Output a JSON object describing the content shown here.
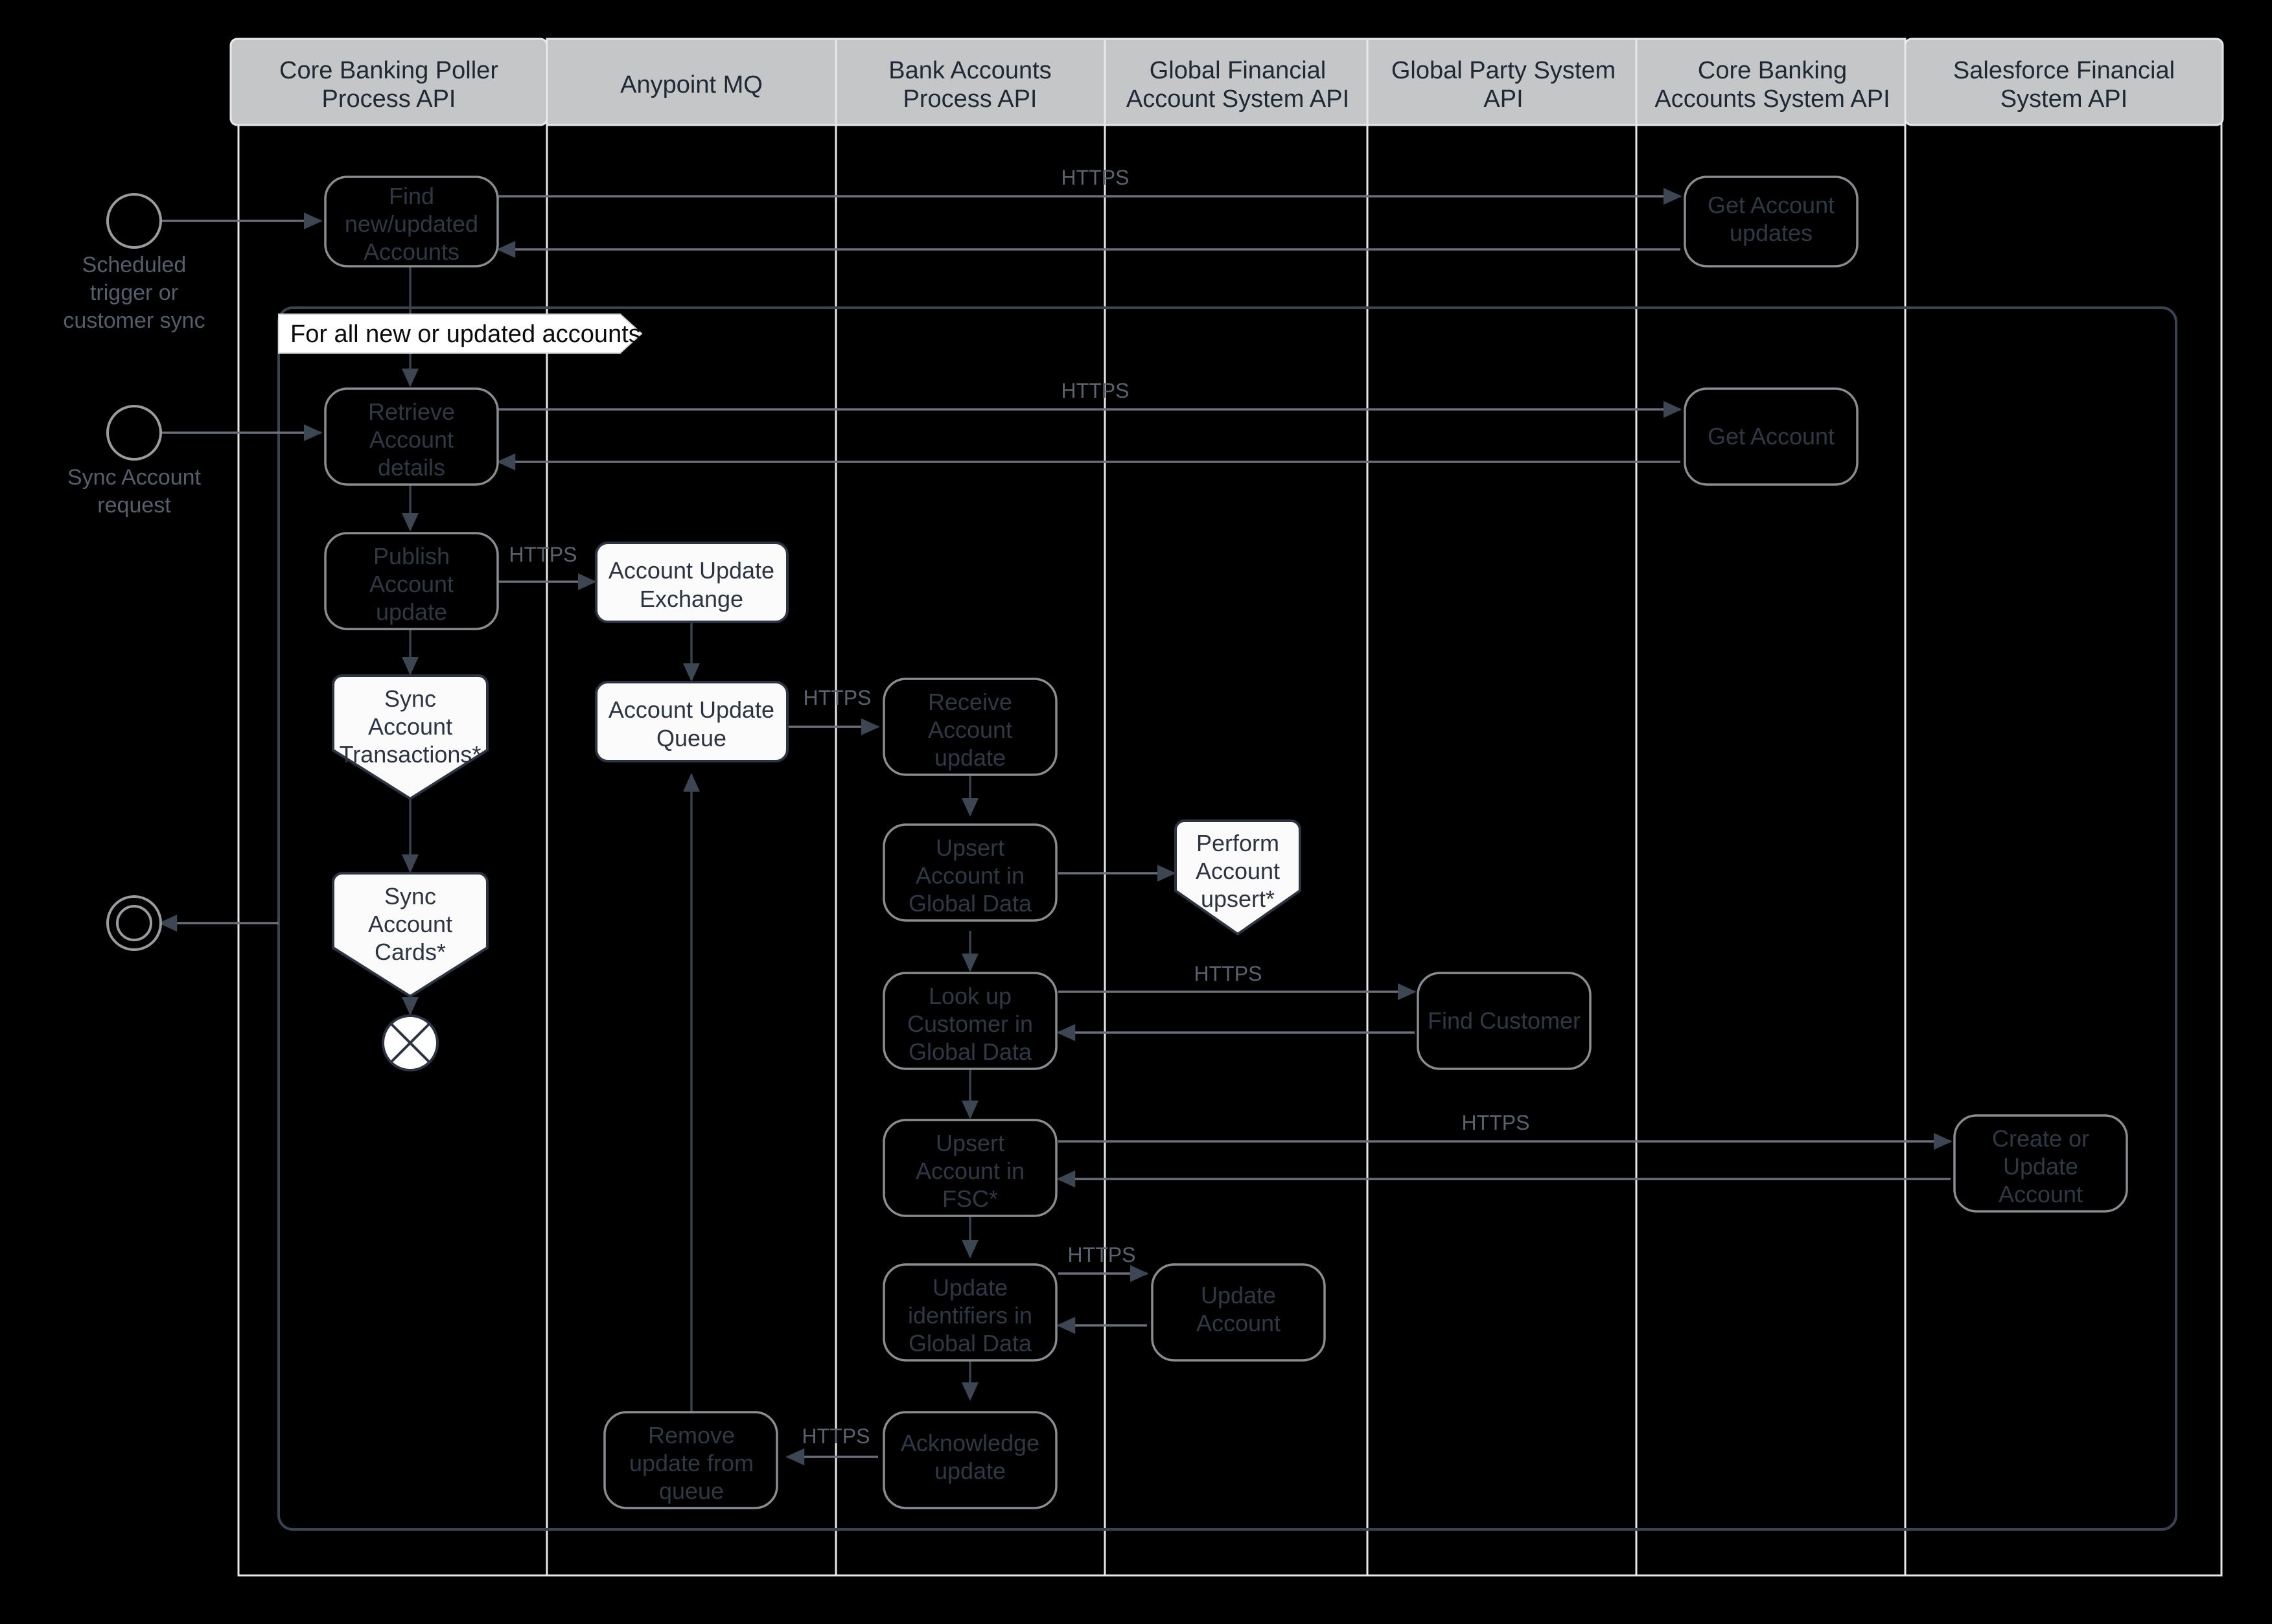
{
  "diagram": {
    "type": "bpmn-swimlane",
    "title": "Account Synchronization Process",
    "background_color": "#000000",
    "lane_header_color": "#c4c6c8",
    "lane_header_text_color": "#1f2933",
    "light_shape_fill": "#fbfbfb",
    "dark_shape_stroke": "#8a8d90",
    "flow_color": "#6b7078"
  },
  "lanes": [
    {
      "id": "lane-core-banking-poller",
      "label": "Core Banking Poller\nProcess API",
      "line1": "Core Banking Poller",
      "line2": "Process API"
    },
    {
      "id": "lane-anypoint-mq",
      "label": "Anypoint MQ",
      "line1": "Anypoint MQ",
      "line2": ""
    },
    {
      "id": "lane-bank-accounts-process",
      "label": "Bank Accounts\nProcess API",
      "line1": "Bank Accounts",
      "line2": "Process API"
    },
    {
      "id": "lane-global-financial-account",
      "label": "Global Financial\nAccount System API",
      "line1": "Global Financial",
      "line2": "Account System API"
    },
    {
      "id": "lane-global-party-system",
      "label": "Global Party System\nAPI",
      "line1": "Global Party System",
      "line2": "API"
    },
    {
      "id": "lane-core-banking-accounts",
      "label": "Core Banking\nAccounts System API",
      "line1": "Core Banking",
      "line2": "Accounts System API"
    },
    {
      "id": "lane-salesforce-financial",
      "label": "Salesforce Financial\nSystem API",
      "line1": "Salesforce Financial",
      "line2": "System API"
    }
  ],
  "start_events": [
    {
      "id": "start-scheduled-trigger",
      "label_lines": [
        "Scheduled",
        "trigger or",
        "customer sync"
      ]
    },
    {
      "id": "start-sync-account-request",
      "label_lines": [
        "Sync Account",
        "request"
      ]
    }
  ],
  "end_events": [
    {
      "id": "end-event-response",
      "label_lines": []
    },
    {
      "id": "terminate-event",
      "label_lines": []
    }
  ],
  "subprocess": {
    "id": "subprocess-for-all-accounts",
    "banner_label": "For all new or updated accounts"
  },
  "tasks": [
    {
      "id": "task-find-new-updated-accounts",
      "style": "dark",
      "lines": [
        "Find",
        "new/updated",
        "Accounts"
      ]
    },
    {
      "id": "task-get-account-updates",
      "style": "dark",
      "lines": [
        "Get Account",
        "updates"
      ]
    },
    {
      "id": "task-retrieve-account-details",
      "style": "dark",
      "lines": [
        "Retrieve",
        "Account",
        "details"
      ]
    },
    {
      "id": "task-get-account",
      "style": "dark",
      "lines": [
        "Get Account"
      ]
    },
    {
      "id": "task-publish-account-update",
      "style": "dark",
      "lines": [
        "Publish",
        "Account",
        "update"
      ]
    },
    {
      "id": "task-account-update-exchange",
      "style": "light",
      "lines": [
        "Account Update",
        "Exchange"
      ]
    },
    {
      "id": "task-account-update-queue",
      "style": "light",
      "lines": [
        "Account Update",
        "Queue"
      ]
    },
    {
      "id": "task-sync-account-transactions",
      "style": "pentagon",
      "lines": [
        "Sync",
        "Account",
        "Transactions*"
      ]
    },
    {
      "id": "task-sync-account-cards",
      "style": "pentagon",
      "lines": [
        "Sync",
        "Account",
        "Cards*"
      ]
    },
    {
      "id": "task-receive-account-update",
      "style": "dark",
      "lines": [
        "Receive",
        "Account",
        "update"
      ]
    },
    {
      "id": "task-upsert-account-global-data",
      "style": "dark",
      "lines": [
        "Upsert",
        "Account in",
        "Global Data"
      ]
    },
    {
      "id": "task-perform-account-upsert",
      "style": "pentagon",
      "lines": [
        "Perform",
        "Account",
        "upsert*"
      ]
    },
    {
      "id": "task-look-up-customer-global-data",
      "style": "dark",
      "lines": [
        "Look up",
        "Customer in",
        "Global Data"
      ]
    },
    {
      "id": "task-find-customer",
      "style": "dark",
      "lines": [
        "Find Customer"
      ]
    },
    {
      "id": "task-upsert-account-fsc",
      "style": "dark",
      "lines": [
        "Upsert",
        "Account in",
        "FSC*"
      ]
    },
    {
      "id": "task-create-or-update-account",
      "style": "dark",
      "lines": [
        "Create or",
        "Update",
        "Account"
      ]
    },
    {
      "id": "task-update-identifiers-global-data",
      "style": "dark",
      "lines": [
        "Update",
        "identifiers in",
        "Global Data"
      ]
    },
    {
      "id": "task-update-account",
      "style": "dark",
      "lines": [
        "Update",
        "Account"
      ]
    },
    {
      "id": "task-acknowledge-update",
      "style": "dark",
      "lines": [
        "Acknowledge",
        "update"
      ]
    },
    {
      "id": "task-remove-update-from-queue",
      "style": "dark",
      "lines": [
        "Remove",
        "update from",
        "queue"
      ]
    }
  ],
  "edge_labels": [
    {
      "id": "edge-https-1",
      "text": "HTTPS"
    },
    {
      "id": "edge-https-2",
      "text": "HTTPS"
    },
    {
      "id": "edge-https-3",
      "text": "HTTPS"
    },
    {
      "id": "edge-https-4",
      "text": "HTTPS"
    },
    {
      "id": "edge-https-5",
      "text": "HTTPS"
    },
    {
      "id": "edge-https-6",
      "text": "HTTPS"
    },
    {
      "id": "edge-https-7",
      "text": "HTTPS"
    },
    {
      "id": "edge-https-8",
      "text": "HTTPS"
    }
  ]
}
